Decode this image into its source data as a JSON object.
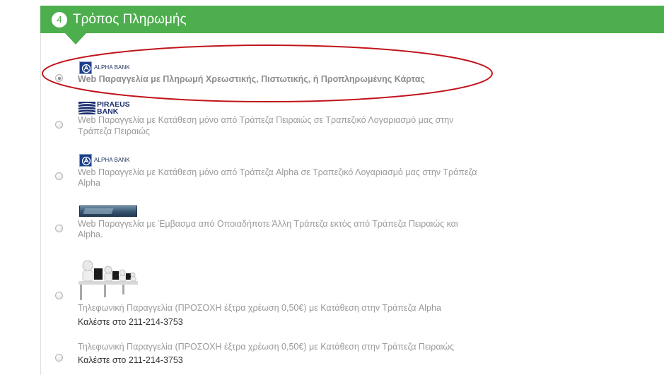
{
  "header": {
    "step_number": "4",
    "title": "Τρόπος Πληρωμής",
    "color": "#4cae4c"
  },
  "options": [
    {
      "logo": "alpha-bank-logo",
      "logo_text": "ALPHA BANK",
      "label": "Web Παραγγελία με Πληρωμή Χρεωστικής, Πιστωτικής, ή Προπληρωμένης Κάρτας",
      "selected": true,
      "highlighted": true
    },
    {
      "logo": "piraeus-bank-logo",
      "logo_text": "PIRAEUS\nBANK",
      "label_line1": "Web Παραγγελία με Κατάθεση μόνο από Τράπεζα Πειραιώς σε Τραπεζικό Λογαριασμό μας στην",
      "label_line2": "Τράπεζα Πειραιώς",
      "selected": false
    },
    {
      "logo": "alpha-bank-logo",
      "logo_text": "ALPHA BANK",
      "label_line1": "Web Παραγγελία με Κατάθεση μόνο από Τράπεζα Alpha σε Τραπεζικό Λογαριασμό μας στην Τράπεζα",
      "label_line2": "Alpha",
      "selected": false
    },
    {
      "logo": "bank-transfer-image",
      "label_line1": "Web Παραγγελία με Έμβασμα από Οποιαδήποτε Άλλη Τράπεζα εκτός από Τράπεζα Πειραιώς και",
      "label_line2": "Alpha.",
      "selected": false
    },
    {
      "logo": "call-center-image",
      "label": "Τηλεφωνική Παραγγελία (ΠΡΟΣΟΧΗ έξτρα χρέωση 0,50€) με Κατάθεση στην Τράπεζα Alpha",
      "phone": "Καλέστε στο 211-214-3753",
      "selected": false
    },
    {
      "label": "Τηλεφωνική Παραγγελία (ΠΡΟΣΟΧΗ έξτρα χρέωση 0,50€) με Κατάθεση στην Τράπεζα Πειραιώς",
      "phone": "Καλέστε στο 211-214-3753",
      "selected": false
    }
  ],
  "highlight_color": "#c0151b"
}
